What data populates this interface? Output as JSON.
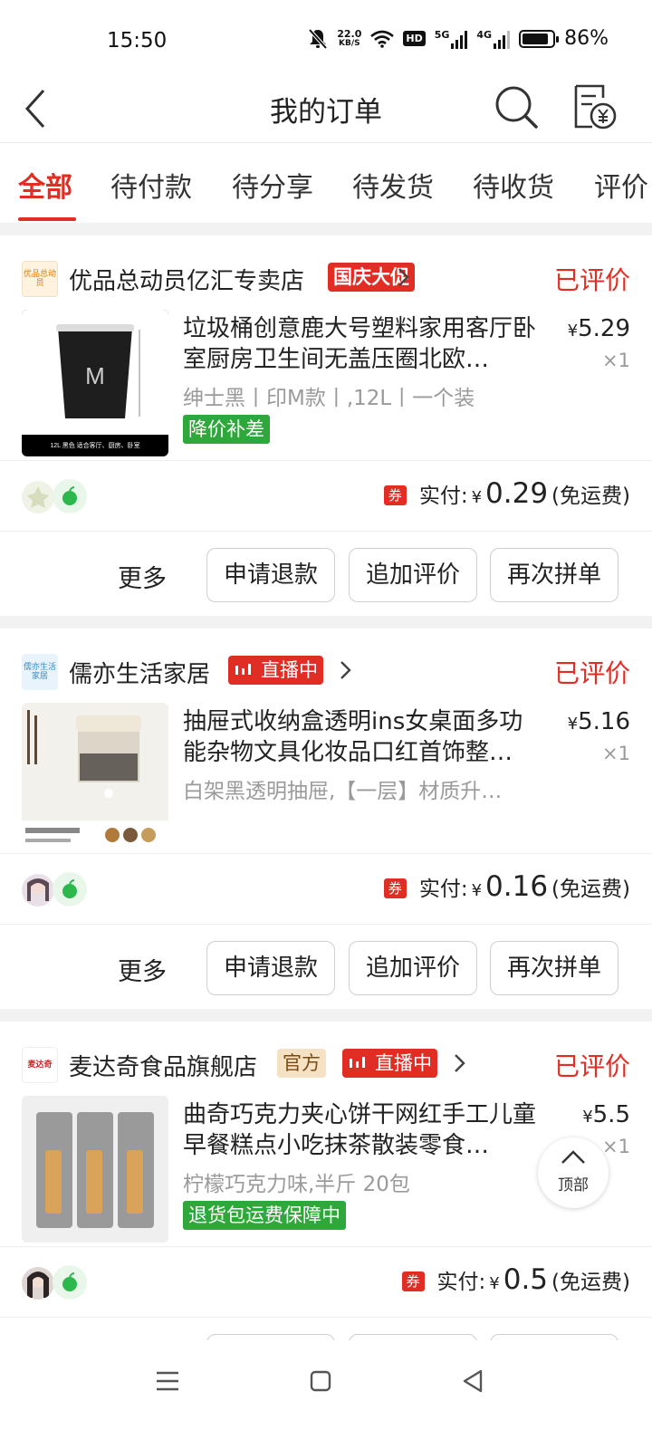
{
  "status_bar": {
    "time": "15:50",
    "net_speed_value": "22.0",
    "net_speed_unit": "KB/S",
    "hd_label": "HD",
    "signal1_label": "5G",
    "signal2_label": "4G",
    "battery_percent": 86,
    "battery_text": "86%"
  },
  "header": {
    "title": "我的订单"
  },
  "tabs": [
    {
      "label": "全部",
      "active": true
    },
    {
      "label": "待付款"
    },
    {
      "label": "待分享"
    },
    {
      "label": "待发货"
    },
    {
      "label": "待收货"
    },
    {
      "label": "评价"
    }
  ],
  "orders": [
    {
      "shop_logo_text": "优品总动员",
      "shop_name": "优品总动员亿汇专卖店",
      "tags": [
        {
          "text": "国庆大促",
          "color": "#e02e24"
        }
      ],
      "status": "已评价",
      "product_title": "垃圾桶创意鹿大号塑料家用客厅卧室厨房卫生间无盖压圈北欧…",
      "thumb_letter": "M",
      "thumb_caption": "12L  黑色  适合客厅、厨房、卧室",
      "price_symbol": "¥",
      "price": "5.29",
      "qty": "×1",
      "spec": "绅士黑丨印M款丨,12L丨一个装",
      "green_badge": "降价补差",
      "pay_coupon": "券",
      "pay_label": "实付:",
      "pay_symbol": "¥",
      "pay_amount": "0.29",
      "pay_note": "(免运费)",
      "more": "更多",
      "buttons": [
        "申请退款",
        "追加评价",
        "再次拼单"
      ]
    },
    {
      "shop_logo_text": "儒亦生活家居",
      "shop_name": "儒亦生活家居",
      "tags": [
        {
          "text": "直播中",
          "color": "#e02e24"
        }
      ],
      "status": "已评价",
      "product_title": "抽屉式收纳盒透明ins女桌面多功能杂物文具化妆品口红首饰整…",
      "price_symbol": "¥",
      "price": "5.16",
      "qty": "×1",
      "spec": "白架黑透明抽屉,【一层】材质升…",
      "pay_coupon": "券",
      "pay_label": "实付:",
      "pay_symbol": "¥",
      "pay_amount": "0.16",
      "pay_note": "(免运费)",
      "more": "更多",
      "buttons": [
        "申请退款",
        "追加评价",
        "再次拼单"
      ]
    },
    {
      "shop_logo_text": "麦达奇",
      "shop_name": "麦达奇食品旗舰店",
      "tags": [
        {
          "text": "官方",
          "color": "#f5e1c4"
        },
        {
          "text": "直播中",
          "color": "#e02e24"
        }
      ],
      "status": "已评价",
      "product_title": "曲奇巧克力夹心饼干网红手工儿童早餐糕点小吃抹茶散装零食…",
      "price_symbol": "¥",
      "price": "5.5",
      "qty": "×1",
      "spec": "柠檬巧克力味,半斤 20包",
      "green_badge": "退货包运费保障中",
      "pay_coupon": "券",
      "pay_label": "实付:",
      "pay_symbol": "¥",
      "pay_amount": "0.5",
      "pay_note": "(免运费)"
    }
  ],
  "back_to_top": "顶部",
  "colors": {
    "accent": "#e02e24",
    "green": "#2ea83a",
    "gap": "#f2f2f2"
  }
}
